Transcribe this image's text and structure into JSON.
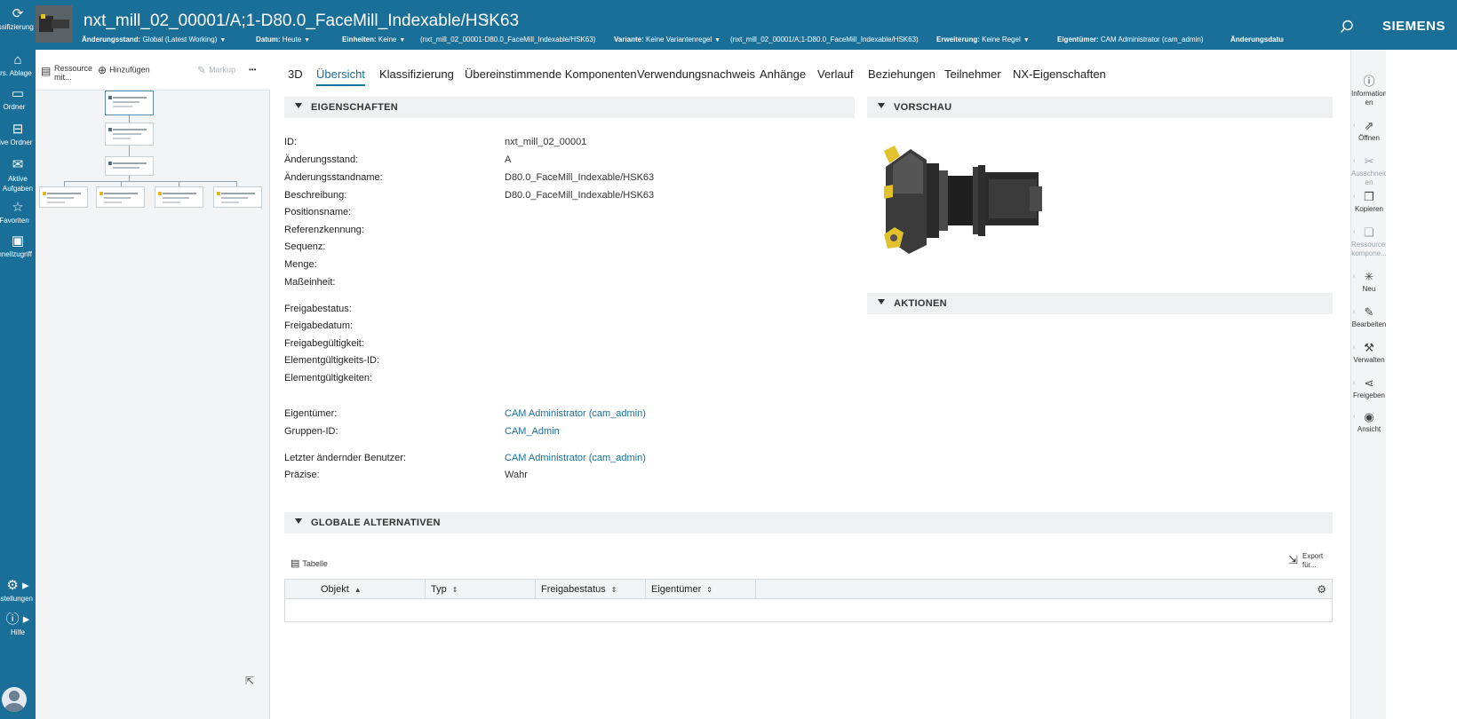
{
  "leftnav": {
    "items": [
      {
        "label": "Klassifizierung",
        "icon": "sync-icon"
      },
      {
        "label": "Pers. Ablage",
        "icon": "home-icon"
      },
      {
        "label": "Ordner",
        "icon": "folder-icon"
      },
      {
        "label": "Aktive Ordner",
        "icon": "active-folder-icon"
      },
      {
        "label": "Aktive Aufgaben",
        "icon": "inbox-icon"
      },
      {
        "label": "Favoriten",
        "icon": "star-icon"
      },
      {
        "label": "Schnellzugriff",
        "icon": "quick-access-icon"
      }
    ],
    "settings_label": "Einstellungen",
    "help_label": "Hilfe"
  },
  "header": {
    "title": "nxt_mill_02_00001/A;1-D80.0_FaceMill_Indexable/HSK63",
    "brand": "SIEMENS",
    "meta": [
      {
        "key": "Änderungsstand:",
        "value": "Global (Latest Working)"
      },
      {
        "key": "Datum:",
        "value": "Heute"
      },
      {
        "key": "Einheiten:",
        "value": "Keine"
      },
      {
        "key": "",
        "value": "(nxt_mill_02_00001-D80.0_FaceMill_Indexable/HSK63)"
      },
      {
        "key": "Variante:",
        "value": "Keine Variantenregel"
      },
      {
        "key": "",
        "value": "(nxt_mill_02_00001/A;1-D80.0_FaceMill_Indexable/HSK63)"
      },
      {
        "key": "Erweiterung:",
        "value": "Keine Regel"
      },
      {
        "key": "Eigentümer:",
        "value": "CAM Administrator (cam_admin)"
      },
      {
        "key": "Änderungsdatum",
        "value": ""
      }
    ]
  },
  "leftpanel": {
    "resource_label": "Ressource mit...",
    "add_label": "Hinzufügen",
    "markup_label": "Markup",
    "more_label": "•••"
  },
  "tabs": [
    "3D",
    "Übersicht",
    "Klassifizierung",
    "Übereinstimmende Komponenten",
    "Verwendungsnachweis",
    "Anhänge",
    "Verlauf",
    "Beziehungen",
    "Teilnehmer",
    "NX-Eigenschaften"
  ],
  "sections": {
    "properties": "EIGENSCHAFTEN",
    "preview": "VORSCHAU",
    "actions": "AKTIONEN",
    "alternatives": "GLOBALE ALTERNATIVEN"
  },
  "properties": [
    {
      "label": "ID:",
      "value": "nxt_mill_02_00001",
      "link": false
    },
    {
      "label": "Änderungsstand:",
      "value": "A",
      "link": false
    },
    {
      "label": "Änderungsstandname:",
      "value": "D80.0_FaceMill_Indexable/HSK63",
      "link": false
    },
    {
      "label": "Beschreibung:",
      "value": "D80.0_FaceMill_Indexable/HSK63",
      "link": false
    },
    {
      "label": "Positionsname:",
      "value": "",
      "link": false
    },
    {
      "label": "Referenzkennung:",
      "value": "",
      "link": false
    },
    {
      "label": "Sequenz:",
      "value": "",
      "link": false
    },
    {
      "label": "Menge:",
      "value": "",
      "link": false
    },
    {
      "label": "Maßeinheit:",
      "value": "",
      "link": false
    },
    {
      "label": "Freigabestatus:",
      "value": "",
      "link": false
    },
    {
      "label": "Freigabedatum:",
      "value": "",
      "link": false
    },
    {
      "label": "Freigabegültigkeit:",
      "value": "",
      "link": false
    },
    {
      "label": "Elementgültigkeits-ID:",
      "value": "",
      "link": false
    },
    {
      "label": "Elementgültigkeiten:",
      "value": "",
      "link": false
    },
    {
      "label": "Eigentümer:",
      "value": "CAM Administrator (cam_admin)",
      "link": true
    },
    {
      "label": "Gruppen-ID:",
      "value": "CAM_Admin",
      "link": true
    },
    {
      "label": "Letzter ändernder Benutzer:",
      "value": "CAM Administrator (cam_admin)",
      "link": true
    },
    {
      "label": "Präzise:",
      "value": "Wahr",
      "link": false
    }
  ],
  "table": {
    "view_label": "Tabelle",
    "export_label_1": "Export",
    "export_label_2": "für...",
    "columns": [
      "Objekt",
      "Typ",
      "Freigabestatus",
      "Eigentümer"
    ]
  },
  "rightrail": [
    {
      "label": "Information en",
      "icon": "info-icon",
      "disabled": false
    },
    {
      "label": "Öffnen",
      "icon": "open-icon",
      "disabled": false
    },
    {
      "label": "Ausschneid en",
      "icon": "cut-icon",
      "disabled": true
    },
    {
      "label": "Kopieren",
      "icon": "copy-icon",
      "disabled": false
    },
    {
      "label": "Ressourcen kompone...",
      "icon": "resource-icon",
      "disabled": true
    },
    {
      "label": "Neu",
      "icon": "new-icon",
      "disabled": false
    },
    {
      "label": "Bearbeiten",
      "icon": "edit-icon",
      "disabled": false
    },
    {
      "label": "Verwalten",
      "icon": "tools-icon",
      "disabled": false
    },
    {
      "label": "Freigeben",
      "icon": "share-icon",
      "disabled": false
    },
    {
      "label": "Ansicht",
      "icon": "eye-icon",
      "disabled": false
    }
  ],
  "colors": {
    "primary": "#1a6f99",
    "accent_gold": "#e1c12c"
  }
}
